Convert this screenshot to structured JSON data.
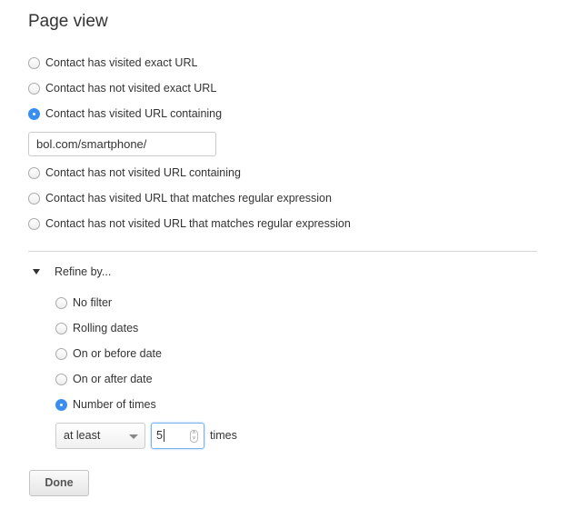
{
  "title": "Page view",
  "url_options": [
    {
      "label": "Contact has visited exact URL",
      "selected": false
    },
    {
      "label": "Contact has not visited exact URL",
      "selected": false
    },
    {
      "label": "Contact has visited URL containing",
      "selected": true
    },
    {
      "label": "Contact has not visited URL containing",
      "selected": false
    },
    {
      "label": "Contact has visited URL that matches regular expression",
      "selected": false
    },
    {
      "label": "Contact has not visited URL that matches regular expression",
      "selected": false
    }
  ],
  "url_value": "bol.com/smartphone/",
  "refine": {
    "label": "Refine by...",
    "options": [
      {
        "label": "No filter",
        "selected": false
      },
      {
        "label": "Rolling dates",
        "selected": false
      },
      {
        "label": "On or before date",
        "selected": false
      },
      {
        "label": "On or after date",
        "selected": false
      },
      {
        "label": "Number of times",
        "selected": true
      }
    ]
  },
  "times": {
    "comparator": "at least",
    "count": "5",
    "suffix": "times"
  },
  "done_label": "Done",
  "accent": "#3a8ef0"
}
